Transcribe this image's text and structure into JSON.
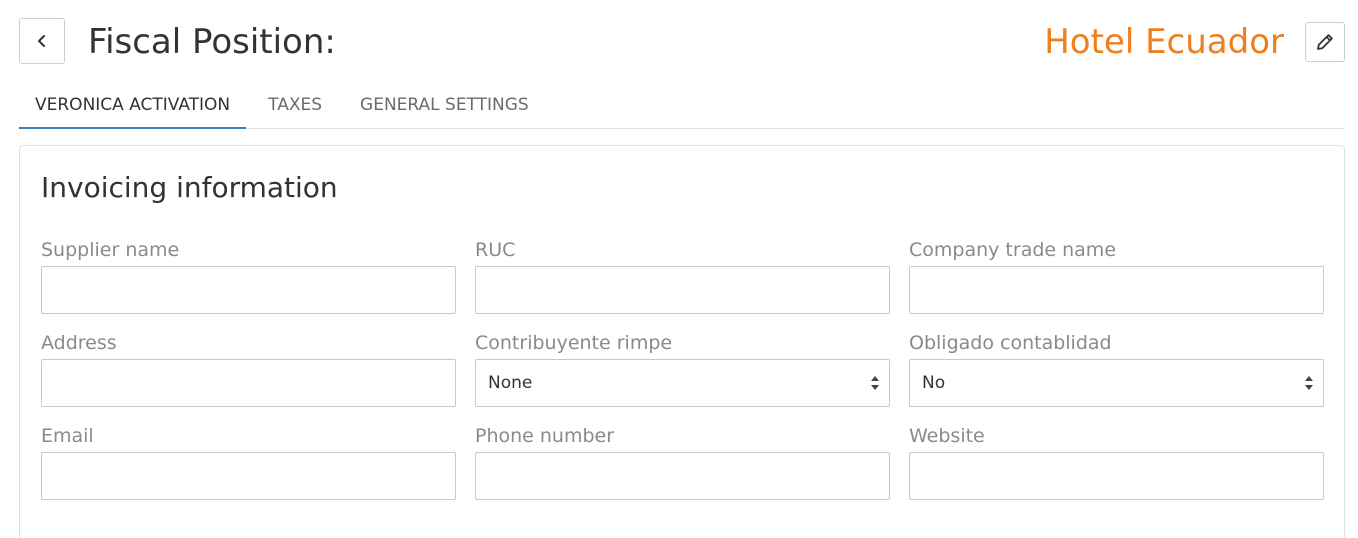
{
  "header": {
    "title": "Fiscal Position:",
    "hotel_name": "Hotel Ecuador"
  },
  "tabs": [
    {
      "label": "VERONICA ACTIVATION",
      "active": true
    },
    {
      "label": "TAXES",
      "active": false
    },
    {
      "label": "GENERAL SETTINGS",
      "active": false
    }
  ],
  "panel": {
    "title": "Invoicing information",
    "fields": {
      "supplier_name": {
        "label": "Supplier name",
        "value": ""
      },
      "ruc": {
        "label": "RUC",
        "value": ""
      },
      "company_trade_name": {
        "label": "Company trade name",
        "value": ""
      },
      "address": {
        "label": "Address",
        "value": ""
      },
      "contribuyente_rimpe": {
        "label": "Contribuyente rimpe",
        "value": "None"
      },
      "obligado_contabilidad": {
        "label": "Obligado contablidad",
        "value": "No"
      },
      "email": {
        "label": "Email",
        "value": ""
      },
      "phone_number": {
        "label": "Phone number",
        "value": ""
      },
      "website": {
        "label": "Website",
        "value": ""
      }
    }
  },
  "colors": {
    "accent": "#f07f1b",
    "tab_underline": "#3d7fb0"
  },
  "icons": {
    "back": "chevron-left-icon",
    "edit": "pencil-icon",
    "select": "sort-arrows-icon"
  }
}
